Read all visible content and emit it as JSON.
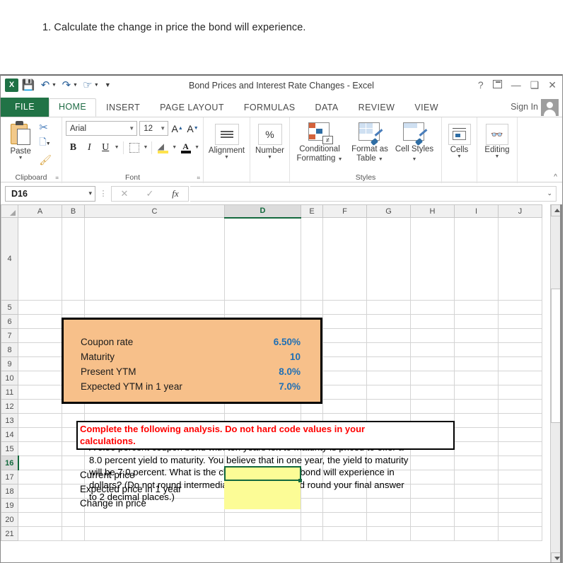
{
  "question": "1. Calculate the change in price the bond will experience.",
  "window": {
    "title": "Bond Prices and Interest Rate Changes - Excel",
    "help_icon": "?",
    "ribbon_display_icon": "ribbon-display-options",
    "minimize_icon": "–",
    "restore_icon": "restore",
    "close_icon": "✕",
    "sign_in": "Sign In"
  },
  "quick_access": {
    "app_logo": "X",
    "save_icon": "save-icon",
    "undo_icon": "undo-icon",
    "redo_icon": "redo-icon",
    "touch_icon": "touch-mode-icon",
    "customize_icon": "customize-icon"
  },
  "tabs": [
    {
      "label": "FILE",
      "type": "file"
    },
    {
      "label": "HOME",
      "type": "active"
    },
    {
      "label": "INSERT",
      "type": "normal"
    },
    {
      "label": "PAGE LAYOUT",
      "type": "normal"
    },
    {
      "label": "FORMULAS",
      "type": "normal"
    },
    {
      "label": "DATA",
      "type": "normal"
    },
    {
      "label": "REVIEW",
      "type": "normal"
    },
    {
      "label": "VIEW",
      "type": "normal"
    }
  ],
  "ribbon": {
    "clipboard": {
      "group_label": "Clipboard",
      "paste_label": "Paste",
      "cut_icon": "scissors-icon",
      "copy_icon": "copy-icon",
      "format_painter_icon": "format-painter-icon",
      "dialog_launcher": "⌐"
    },
    "font": {
      "group_label": "Font",
      "font_name": "Arial",
      "font_size": "12",
      "grow_font_label": "A",
      "shrink_font_label": "A",
      "bold_label": "B",
      "italic_label": "I",
      "underline_label": "U",
      "borders_icon": "borders-icon",
      "fill_color_icon": "fill-color-icon",
      "font_color_label": "A",
      "dialog_launcher": "⌐"
    },
    "alignment": {
      "label": "Alignment",
      "icon": "alignment-icon"
    },
    "number": {
      "label": "Number",
      "icon": "%"
    },
    "styles": {
      "group_label": "Styles",
      "conditional_formatting": "Conditional Formatting",
      "format_as_table": "Format as Table",
      "cell_styles": "Cell Styles"
    },
    "cells": {
      "label": "Cells",
      "icon": "cells-icon"
    },
    "editing": {
      "label": "Editing",
      "icon": "binoculars-icon"
    },
    "collapse_icon": "^"
  },
  "formula_bar": {
    "name_box": "D16",
    "cancel_icon": "✕",
    "enter_icon": "✓",
    "function_icon": "fx",
    "formula_value": "",
    "expand_icon": "⌄"
  },
  "sheet": {
    "columns": [
      "A",
      "B",
      "C",
      "D",
      "E",
      "F",
      "G",
      "H",
      "I",
      "J"
    ],
    "selected_column": "D",
    "rows": [
      "4",
      "5",
      "6",
      "7",
      "8",
      "9",
      "10",
      "11",
      "12",
      "13",
      "14",
      "15",
      "16",
      "17",
      "18",
      "19",
      "20",
      "21"
    ],
    "selected_row": "16",
    "selected_cell": "D16",
    "question_text": "A 6.50 percent coupon bond with ten years left to maturity is priced to offer a 8.0 percent yield to maturity. You believe that in one year, the yield to maturity will be 7.0 percent. What is the change in price the bond will experience in dollars? (Do not round intermediate calculations and round your final answer to 2 decimal places.)",
    "input_block": {
      "fill_color": "#f7c08a",
      "value_color": "#1f6fb5",
      "rows": [
        {
          "label": "Coupon rate",
          "value": "6.50%"
        },
        {
          "label": "Maturity",
          "value": "10"
        },
        {
          "label": "Present YTM",
          "value": "8.0%"
        },
        {
          "label": "Expected YTM in 1 year",
          "value": "7.0%"
        }
      ]
    },
    "warning_box": {
      "text_color": "#ff0000",
      "line1": "Complete the following analysis. Do not hard code values in your",
      "line2": "calculations."
    },
    "output_rows": [
      {
        "label": "Current price",
        "value": ""
      },
      {
        "label": "Expected price in 1 year",
        "value": ""
      },
      {
        "label": "Change in price",
        "value": ""
      }
    ],
    "output_fill": "#fcfc96"
  }
}
